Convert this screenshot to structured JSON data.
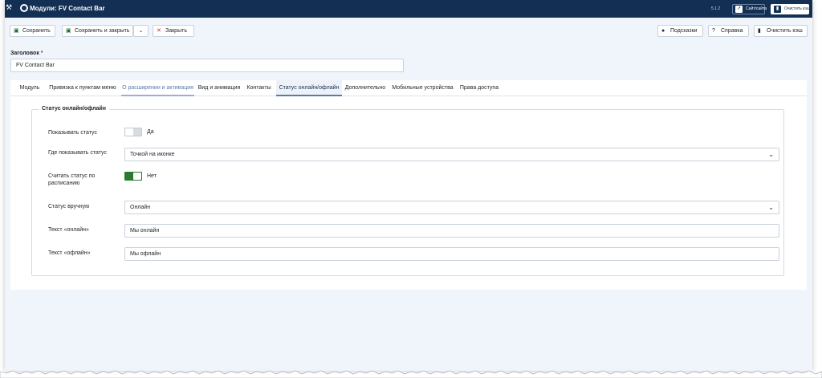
{
  "header": {
    "title": "Модули: FV Contact Bar",
    "version": "5.1.2",
    "site_label": "Сайт/сайта",
    "clear_cache_label": "Очистить кэш"
  },
  "toolbar": {
    "save_label": "Сохранить",
    "save_close_label": "Сохранить и закрыть",
    "close_label": "Закрыть",
    "hints_label": "Подсказки",
    "help_label": "Справка",
    "clear_cache_label": "Очистить кэш"
  },
  "title_field": {
    "label": "Заголовок",
    "required_mark": "*",
    "value": "FV Contact Bar"
  },
  "tabs": [
    {
      "label": "Модуль"
    },
    {
      "label": "Привязка к пунктам меню"
    },
    {
      "label": "О расширении и активация"
    },
    {
      "label": "Вид и анимация"
    },
    {
      "label": "Контакты"
    },
    {
      "label": "Статус онлайн/офлайн"
    },
    {
      "label": "Дополнительно"
    },
    {
      "label": "Мобильные устройства"
    },
    {
      "label": "Права доступа"
    }
  ],
  "active_tab": "Статус онлайн/офлайн",
  "fieldset": {
    "legend": "Статус онлайн/офлайн",
    "show_status": {
      "label": "Показывать статус",
      "value": "Да"
    },
    "where_show": {
      "label": "Где показывать статус",
      "value": "Точкой на иконке"
    },
    "schedule": {
      "label": "Считать статус по расписанию",
      "value": "Нет"
    },
    "manual_status": {
      "label": "Статус вручную",
      "value": "Онлайн"
    },
    "online_text": {
      "label": "Текст «онлайн»",
      "value": "Мы онлайн"
    },
    "offline_text": {
      "label": "Текст «офлайн»",
      "value": "Мы офлайн"
    }
  },
  "colors": {
    "header_bg": "#132f53",
    "page_bg": "#f0f4fb",
    "toggle_on": "#2a7a2f",
    "close_red": "#c52827",
    "save_green": "#1b6c37"
  },
  "icons": {
    "save": "save-icon",
    "close": "close-icon",
    "hints": "info-icon",
    "help": "question-icon",
    "trash": "trash-icon",
    "chevron": "chevron-down-icon"
  }
}
